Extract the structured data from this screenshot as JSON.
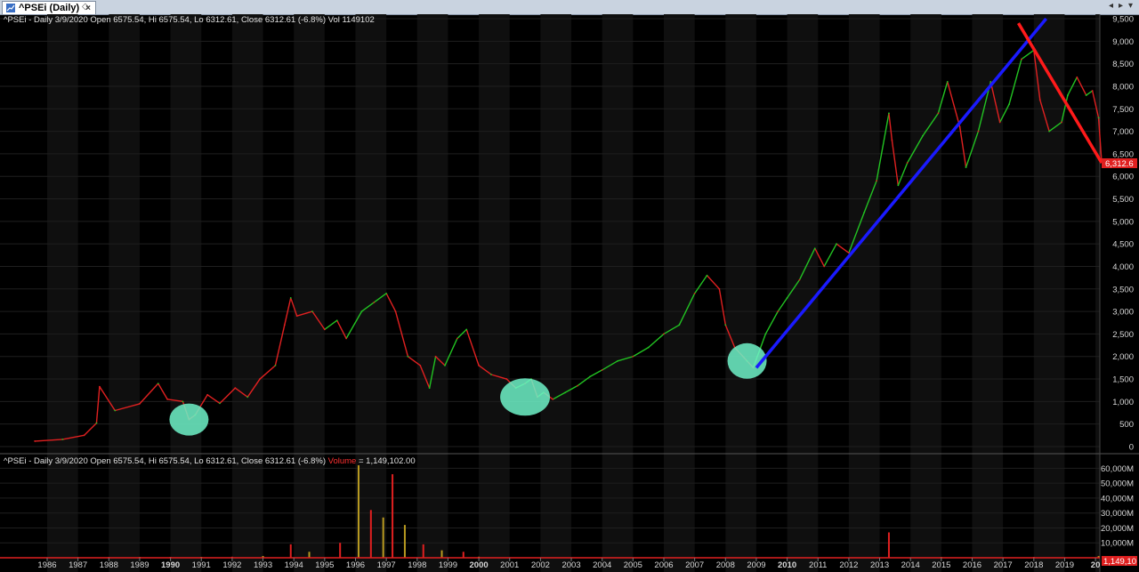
{
  "tab": {
    "title": "^PSEi (Daily)",
    "close": "×"
  },
  "nav": {
    "prev": "◂",
    "next": "▸",
    "down": "▾"
  },
  "price_header": "^PSEi - Daily 3/9/2020 Open 6575.54, Hi 6575.54, Lo 6312.61, Close 6312.61 (-6.8%) Vol 1149102",
  "volume_header": {
    "prefix": "^PSEi - Daily 3/9/2020 Open 6575.54, Hi 6575.54, Lo 6312.61, Close 6312.61 (-6.8%) ",
    "vol_label": "Volume",
    "suffix": " = 1,149,102.00"
  },
  "last_price_tag": "6,312.6",
  "last_volume_tag": "1,149,10",
  "colors": {
    "up": "#22c322",
    "down": "#e02020",
    "trend_up": "#1a1aff",
    "trend_down": "#ff1a1a",
    "highlight": "#6ff2c8",
    "bg": "#000000",
    "band": "#0f0f0f"
  },
  "chart_data": [
    {
      "type": "line",
      "title": "^PSEi (Daily)",
      "x_ticks": [
        "1986",
        "1987",
        "1988",
        "1989",
        "1990",
        "1991",
        "1992",
        "1993",
        "1994",
        "1995",
        "1996",
        "1997",
        "1998",
        "1999",
        "2000",
        "2001",
        "2002",
        "2003",
        "2004",
        "2005",
        "2006",
        "2007",
        "2008",
        "2009",
        "2010",
        "2011",
        "2012",
        "2013",
        "2014",
        "2015",
        "2016",
        "2017",
        "2018",
        "2019",
        "20"
      ],
      "y_ticks": [
        "9,500",
        "9,000",
        "8,500",
        "8,000",
        "7,500",
        "7,000",
        "6,500",
        "6,000",
        "5,500",
        "5,000",
        "4,500",
        "4,000",
        "3,500",
        "3,000",
        "2,500",
        "2,000",
        "1,500",
        "1,000",
        "500",
        "0"
      ],
      "ylim": [
        0,
        9500
      ],
      "x": [
        1985.6,
        1986.5,
        1987.2,
        1987.6,
        1987.7,
        1988.2,
        1989.0,
        1989.6,
        1989.9,
        1990.4,
        1990.6,
        1990.8,
        1991.2,
        1991.6,
        1992.1,
        1992.5,
        1992.9,
        1993.4,
        1993.7,
        1993.9,
        1994.1,
        1994.6,
        1995.0,
        1995.4,
        1995.7,
        1996.2,
        1996.6,
        1997.0,
        1997.3,
        1997.7,
        1998.1,
        1998.4,
        1998.6,
        1998.9,
        1999.3,
        1999.6,
        2000.0,
        2000.4,
        2000.9,
        2001.2,
        2001.5,
        2001.7,
        2001.9,
        2002.1,
        2002.4,
        2002.8,
        2003.2,
        2003.6,
        2004.0,
        2004.5,
        2005.0,
        2005.5,
        2006.0,
        2006.5,
        2007.0,
        2007.4,
        2007.8,
        2008.0,
        2008.3,
        2008.7,
        2008.9,
        2009.3,
        2009.7,
        2010.0,
        2010.4,
        2010.9,
        2011.2,
        2011.6,
        2012.0,
        2012.5,
        2012.9,
        2013.3,
        2013.4,
        2013.6,
        2013.9,
        2014.4,
        2014.9,
        2015.2,
        2015.6,
        2015.8,
        2016.2,
        2016.6,
        2016.9,
        2017.2,
        2017.6,
        2018.0,
        2018.2,
        2018.5,
        2018.9,
        2019.1,
        2019.4,
        2019.7,
        2019.9,
        2020.1,
        2020.2
      ],
      "values": [
        120,
        160,
        250,
        520,
        1330,
        800,
        950,
        1400,
        1050,
        1000,
        600,
        700,
        1150,
        960,
        1300,
        1100,
        1500,
        1800,
        2700,
        3300,
        2900,
        3000,
        2600,
        2800,
        2400,
        3000,
        3200,
        3400,
        3000,
        2000,
        1800,
        1300,
        2000,
        1800,
        2400,
        2600,
        1800,
        1600,
        1500,
        1300,
        1400,
        1500,
        1100,
        1200,
        1050,
        1200,
        1350,
        1550,
        1700,
        1900,
        2000,
        2200,
        2500,
        2700,
        3400,
        3800,
        3500,
        2700,
        2200,
        1900,
        1750,
        2500,
        3000,
        3300,
        3700,
        4400,
        4000,
        4500,
        4300,
        5200,
        5900,
        7400,
        6800,
        5800,
        6300,
        6900,
        7400,
        8100,
        7100,
        6200,
        7000,
        8100,
        7200,
        7600,
        8600,
        8800,
        7700,
        7000,
        7200,
        7800,
        8200,
        7800,
        7900,
        7300,
        6312
      ]
    },
    {
      "type": "bar",
      "title": "Volume",
      "x_ticks": [
        "1986",
        "1987",
        "1988",
        "1989",
        "1990",
        "1991",
        "1992",
        "1993",
        "1994",
        "1995",
        "1996",
        "1997",
        "1998",
        "1999",
        "2000",
        "2001",
        "2002",
        "2003",
        "2004",
        "2005",
        "2006",
        "2007",
        "2008",
        "2009",
        "2010",
        "2011",
        "2012",
        "2013",
        "2014",
        "2015",
        "2016",
        "2017",
        "2018",
        "2019",
        "20"
      ],
      "y_ticks": [
        "60,000M",
        "50,000M",
        "40,000M",
        "30,000M",
        "20,000M",
        "10,000M"
      ],
      "ylim": [
        0,
        65000
      ],
      "x": [
        1986.0,
        1987.0,
        1988.0,
        1989.0,
        1990.0,
        1991.0,
        1992.0,
        1993.0,
        1993.9,
        1994.5,
        1995.5,
        1996.1,
        1996.5,
        1996.9,
        1997.2,
        1997.6,
        1998.2,
        1998.8,
        1999.5,
        2000.0,
        2001.0,
        2002.0,
        2005.0,
        2010.0,
        2013.3,
        2015.0,
        2018.0,
        2020.1
      ],
      "values": [
        300,
        400,
        500,
        500,
        600,
        600,
        700,
        1200,
        9000,
        4000,
        10000,
        62000,
        32000,
        27000,
        56000,
        22000,
        9000,
        5000,
        4000,
        700,
        300,
        200,
        300,
        400,
        17000,
        500,
        600,
        1149
      ]
    }
  ],
  "annotations": {
    "highlight_circles": [
      "1990",
      "2001",
      "2009"
    ],
    "uptrend_line": {
      "from_year": 2009.0,
      "from_value": 1750,
      "to_year": 2018.4,
      "to_value": 9500
    },
    "downtrend_line": {
      "from_year": 2017.5,
      "from_value": 9400,
      "to_year": 2020.2,
      "to_value": 6300
    }
  }
}
